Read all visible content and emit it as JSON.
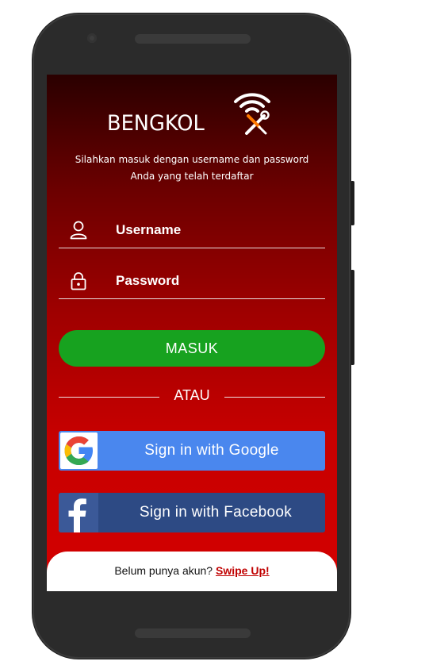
{
  "app": {
    "brand": "BENGKOL",
    "subtitle_line1": "Silahkan masuk dengan username dan password",
    "subtitle_line2": "Anda yang telah terdaftar"
  },
  "form": {
    "username_label": "Username",
    "password_label": "Password",
    "submit_label": "MASUK",
    "divider_label": "ATAU"
  },
  "social": {
    "google_label": "Sign in with Google",
    "facebook_label": "Sign in with Facebook"
  },
  "footer": {
    "prompt": "Belum punya akun? ",
    "link": "Swipe Up!"
  },
  "icons": [
    "wifi-icon",
    "tools-icon",
    "user-icon",
    "lock-icon",
    "google-icon",
    "facebook-icon"
  ],
  "colors": {
    "primary_red": "#d40000",
    "dark_red": "#2a0000",
    "green_button": "#17a21f",
    "google_blue": "#4a87ee",
    "facebook_blue": "#2d4a84",
    "link_red": "#c00000"
  }
}
